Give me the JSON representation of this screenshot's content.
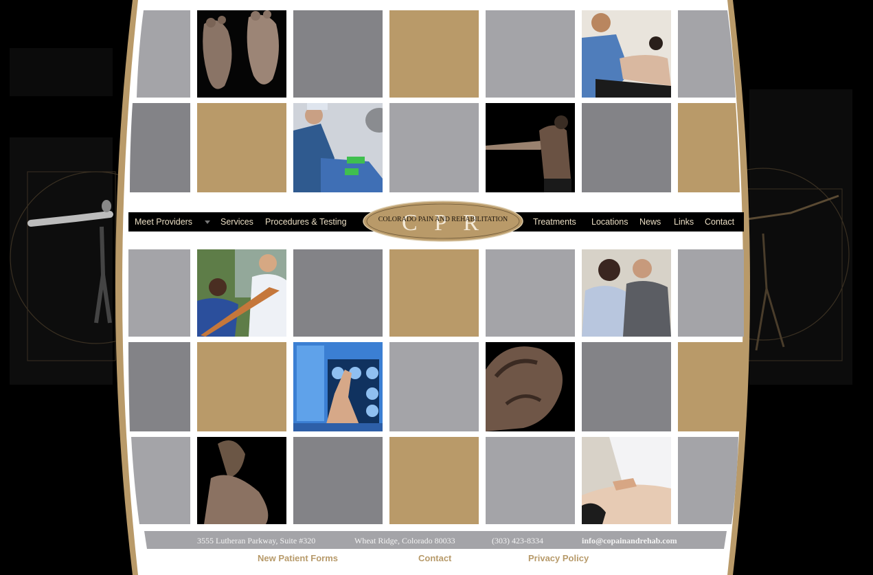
{
  "colors": {
    "gold": "#b99a69",
    "light_gray": "#a4a4a8",
    "dark_gray": "#838387",
    "white": "#ffffff",
    "nav_text": "#e9dcc2",
    "footer_link": "#b79a6a"
  },
  "logo": {
    "monogram": "C P R",
    "name": "COLORADO PAIN AND REHABILITATION"
  },
  "nav": {
    "left": [
      "Meet Providers",
      "Services",
      "Procedures & Testing"
    ],
    "right": [
      "Treatments",
      "Locations",
      "News",
      "Links",
      "Contact"
    ]
  },
  "photos": [
    "feet-photo",
    "chiropractor-back-photo",
    "surgeon-procedure-photo",
    "outstretched-arm-photo",
    "resistance-band-therapy-photo",
    "doctor-consultation-photo",
    "xray-scan-photo",
    "muscular-back-photo",
    "woman-shoulder-photo",
    "back-massage-photo"
  ],
  "footer": {
    "address": "3555 Lutheran Parkway, Suite #320",
    "city": "Wheat Ridge, Colorado 80033",
    "phone": "(303) 423-8334",
    "email": "info@copainandrehab.com",
    "links": [
      "New Patient Forms",
      "Contact",
      "Privacy Policy"
    ]
  }
}
